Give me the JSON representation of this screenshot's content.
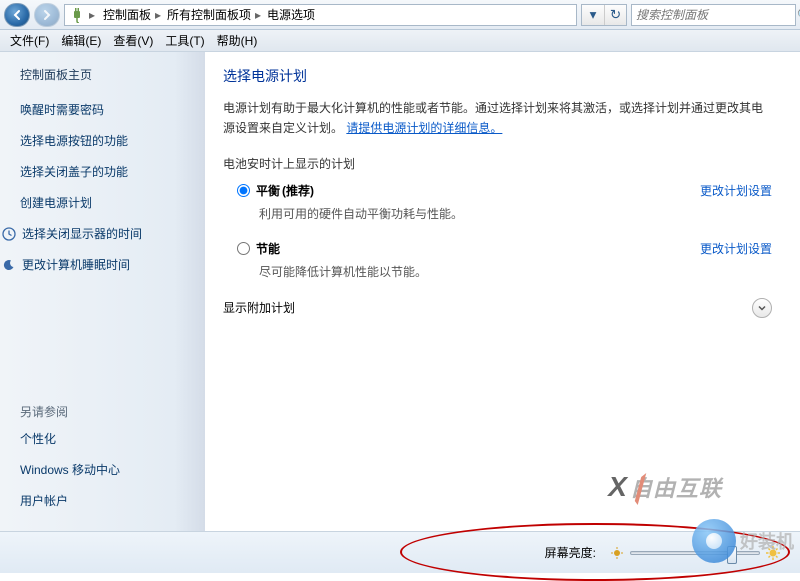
{
  "nav": {
    "breadcrumb": [
      "控制面板",
      "所有控制面板项",
      "电源选项"
    ]
  },
  "search": {
    "placeholder": "搜索控制面板"
  },
  "menu": [
    "文件(F)",
    "编辑(E)",
    "查看(V)",
    "工具(T)",
    "帮助(H)"
  ],
  "sidebar": {
    "home": "控制面板主页",
    "links": [
      "唤醒时需要密码",
      "选择电源按钮的功能",
      "选择关闭盖子的功能",
      "创建电源计划"
    ],
    "iconlinks": [
      {
        "icon": "clock-icon",
        "label": "选择关闭显示器的时间"
      },
      {
        "icon": "moon-icon",
        "label": "更改计算机睡眠时间"
      }
    ],
    "see_also_title": "另请参阅",
    "see_also": [
      "个性化",
      "Windows 移动中心",
      "用户帐户"
    ]
  },
  "main": {
    "title": "选择电源计划",
    "desc_prefix": "电源计划有助于最大化计算机的性能或者节能。通过选择计划来将其激活，或选择计划并通过更改其电源设置来自定义计划。",
    "desc_link": "请提供电源计划的详细信息。",
    "section_label": "电池安时计上显示的计划",
    "plans": [
      {
        "name": "平衡",
        "rec": "(推荐)",
        "desc": "利用可用的硬件自动平衡功耗与性能。",
        "link": "更改计划设置",
        "checked": true
      },
      {
        "name": "节能",
        "rec": "",
        "desc": "尽可能降低计算机性能以节能。",
        "link": "更改计划设置",
        "checked": false
      }
    ],
    "show_more": "显示附加计划"
  },
  "bottom": {
    "brightness_label": "屏幕亮度:",
    "brightness_value": 75
  },
  "watermark1": "自由互联",
  "watermark2": "好装机"
}
